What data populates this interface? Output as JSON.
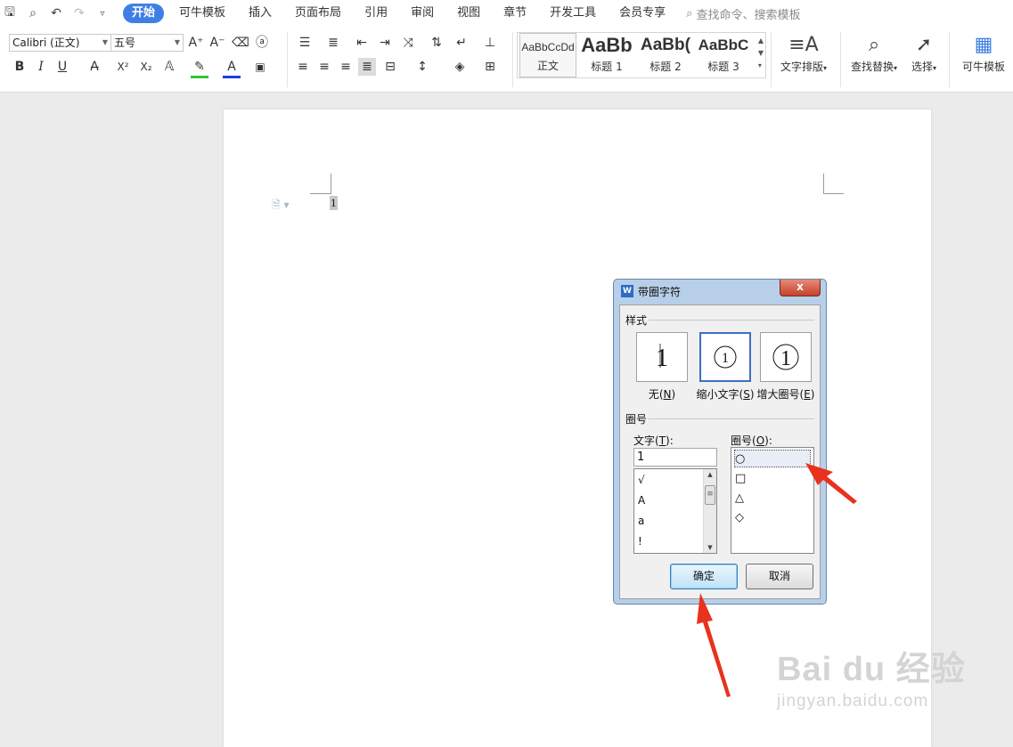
{
  "menubar": {
    "tabs": [
      "开始",
      "可牛模板",
      "插入",
      "页面布局",
      "引用",
      "审阅",
      "视图",
      "章节",
      "开发工具",
      "会员专享"
    ],
    "active_tab": "开始",
    "search_placeholder": "查找命令、搜索模板"
  },
  "ribbon": {
    "font_name": "Calibri (正文)",
    "font_size": "五号",
    "styles": [
      {
        "preview": "AaBbCcDd",
        "caption": "正文"
      },
      {
        "preview": "AaBb",
        "caption": "标题 1"
      },
      {
        "preview": "AaBb(",
        "caption": "标题 2"
      },
      {
        "preview": "AaBbC",
        "caption": "标题 3"
      }
    ],
    "text_layout_label": "文字排版",
    "find_replace_label": "查找替换",
    "select_label": "选择",
    "template_label": "可牛模板",
    "icons": {
      "bold": "B",
      "italic": "I",
      "underline": "U",
      "superscript": "X²",
      "subscript": "X₂"
    }
  },
  "document": {
    "selected_char": "1"
  },
  "dialog": {
    "title": "带圈字符",
    "close": "x",
    "style_group": "样式",
    "styles": [
      {
        "label": "无",
        "key": "N"
      },
      {
        "label": "缩小文字",
        "key": "S"
      },
      {
        "label": "增大圈号",
        "key": "E"
      }
    ],
    "enclosure_group": "圈号",
    "text_label": "文字",
    "text_key": "T",
    "text_value": "1",
    "text_list": [
      "√",
      "A",
      "a",
      "!"
    ],
    "shape_label": "圈号",
    "shape_key": "O",
    "shapes": [
      "○",
      "□",
      "△",
      "◇"
    ],
    "ok_button": "确定",
    "cancel_button": "取消"
  },
  "watermark": {
    "line1": "Bai du 经验",
    "line2": "jingyan.baidu.com"
  },
  "colors": {
    "accent": "#3f7fe4",
    "dialog_frame": "#b7cfe9",
    "annotation": "#e8321e"
  }
}
